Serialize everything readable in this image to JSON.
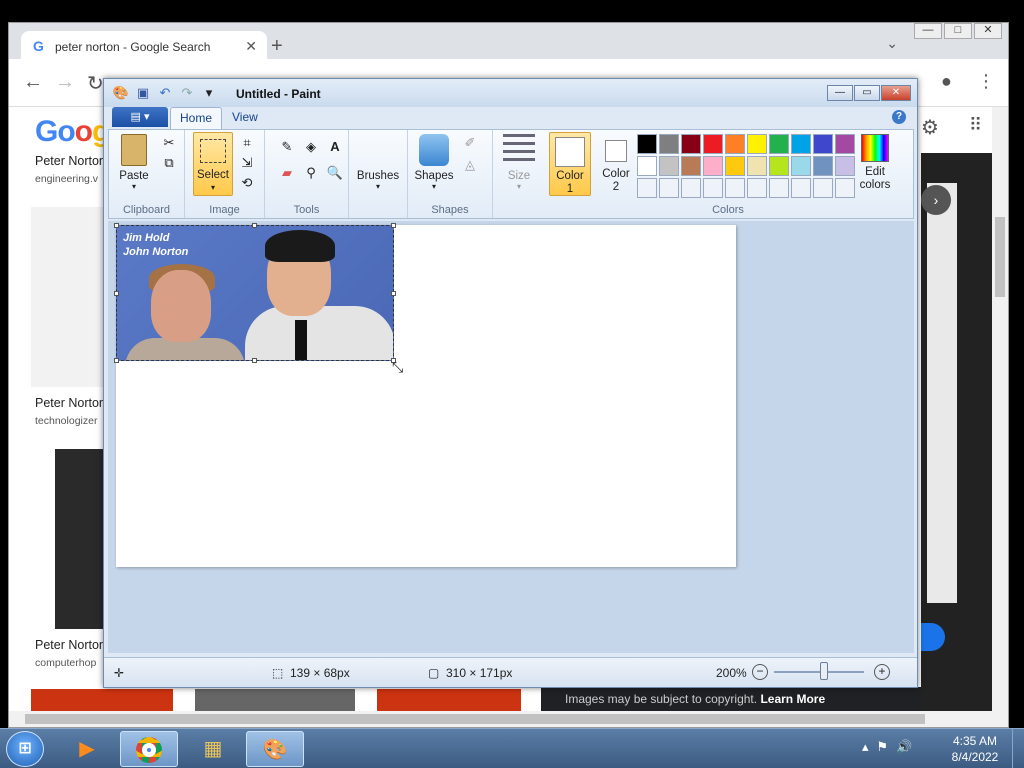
{
  "browser": {
    "tab_title": "peter norton - Google Search",
    "tab_icon": "G",
    "logo_part1": "Go",
    "logo_part2": "o",
    "logo_part3": "g",
    "results": [
      {
        "title": "Peter Norton",
        "source": "engineering.v"
      },
      {
        "title": "Peter Norton",
        "source": "technologizer"
      },
      {
        "title": "Peter Norton",
        "source": "computerhop"
      }
    ],
    "copyright_text": "Images may be subject to copyright.",
    "learn_more": "Learn More"
  },
  "paint": {
    "title": "Untitled - Paint",
    "tabs": {
      "home": "Home",
      "view": "View"
    },
    "groups": {
      "clipboard": "Clipboard",
      "image": "Image",
      "tools": "Tools",
      "shapes": "Shapes",
      "colors": "Colors"
    },
    "buttons": {
      "paste": "Paste",
      "select": "Select",
      "brushes": "Brushes",
      "shapes": "Shapes",
      "size": "Size",
      "color1_line1": "Color",
      "color1_line2": "1",
      "color2_line1": "Color",
      "color2_line2": "2",
      "edit_colors_line1": "Edit",
      "edit_colors_line2": "colors"
    },
    "palette_row1": [
      "#000000",
      "#7f7f7f",
      "#880015",
      "#ed1c24",
      "#ff7f27",
      "#fff200",
      "#22b14c",
      "#00a2e8",
      "#3f48cc",
      "#a349a4"
    ],
    "palette_row2": [
      "#ffffff",
      "#c3c3c3",
      "#b97a57",
      "#ffaec9",
      "#ffc90e",
      "#efe4b0",
      "#b5e61d",
      "#99d9ea",
      "#7092be",
      "#c8bfe7"
    ],
    "photo_text_line1": "Jim Hold",
    "photo_text_line2": "John Norton",
    "status": {
      "selection_size": "139 × 68px",
      "image_size": "310 × 171px",
      "zoom": "200%"
    }
  },
  "taskbar": {
    "time": "4:35 AM",
    "date": "8/4/2022"
  }
}
